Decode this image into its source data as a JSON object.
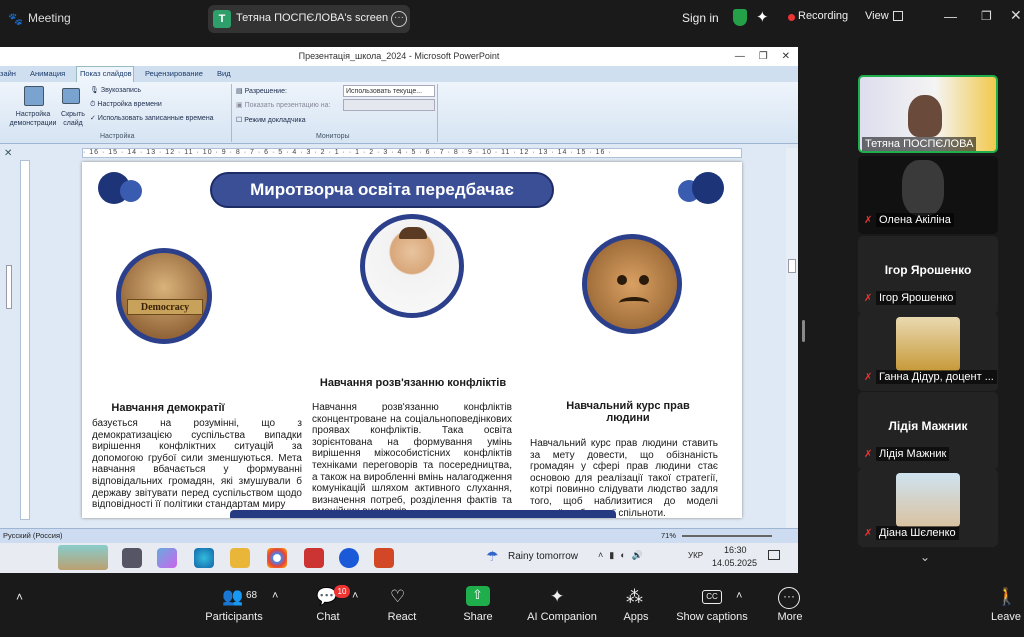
{
  "top": {
    "app_title": "Meeting",
    "sharer_initial": "Т",
    "sharer_label": "Тетяна ПОСПЄЛОВА's screen",
    "sign_in": "Sign in",
    "recording": "Recording",
    "view": "View"
  },
  "ppt": {
    "window_title": "Презентація_школа_2024 - Microsoft PowerPoint",
    "tabs": [
      "зайн",
      "Анимация",
      "Показ слайдов",
      "Рецензирование",
      "Вид"
    ],
    "ribbon": {
      "setup_label": "Настройка демонстрации",
      "hide_label": "Скрыть слайд",
      "record_narration": "Звукозапись",
      "rehearse": "Настройка времени",
      "use_timings": "Использовать записанные времена",
      "group_setup": "Настройка",
      "resolution": "Разрешение:",
      "resolution_value": "Использовать текуще...",
      "show_on": "Показать презентацию на:",
      "presenter_view": "Режим докладчика",
      "group_monitors": "Мониторы"
    },
    "ruler": "· 16 · 15 · 14 · 13 · 12 · 11 · 10 · 9 · 8 · 7 · 6 · 5 · 4 · 3 · 2 · 1 · · 1 · 2 · 3 · 4 · 5 · 6 · 7 · 8 · 9 · 10 · 11 · 12 · 13 · 14 · 15 · 16 ·",
    "status_lang": "Русский (Россия)",
    "zoom": "71%"
  },
  "slide": {
    "banner": "Миротворча освіта передбачає",
    "items": [
      {
        "title": "Навчання демократії",
        "badge": "Democracy",
        "text": "базується на розумінні, що з демократизацією суспільства випадки вирішення конфліктних ситуацій за допомогою грубої сили зменшуються. Мета навчання вбачається у формуванні відповідальних громадян, які змушували б державу звітувати перед суспільством щодо відповідності її політики стандартам миру"
      },
      {
        "title": "Навчання розв'язанню конфліктів",
        "text": "Навчання розв'язанню конфліктів сконцентроване на соціальноповедінкових проявах конфліктів. Така освіта зорієнтована на формування умінь вирішення міжособистісних конфліктів техніками переговорів та посередництва, а також на виробленні вмінь налагодження комунікацій шляхом активного слухання, визначення потреб, розділення фактів та емоційних висновків.."
      },
      {
        "title": "Навчальний курс прав людини",
        "text": "Навчальний курс прав людини ставить за мету довести, що обізнаність громадян у сфері прав людини стає основою для реалізації такої стратегії, котрі повинно слідувати людство задля того, щоб наблизитися до моделі мирної глобальної спільноти."
      }
    ]
  },
  "taskbar": {
    "weather": "Rainy tomorrow",
    "lang": "УКР",
    "time": "16:30",
    "date": "14.05.2025"
  },
  "participants": [
    {
      "name": "Тетяна ПОСПЄЛОВА",
      "video": true,
      "muted": false
    },
    {
      "name": "Олена Акіліна",
      "video": true,
      "muted": true
    },
    {
      "name": "Ігор Ярошенко",
      "video": false,
      "muted": true
    },
    {
      "name": "Ганна Дідур, доцент ...",
      "video": true,
      "muted": true
    },
    {
      "name": "Лідія Мажник",
      "video": false,
      "muted": true
    },
    {
      "name": "Діана Шєленко",
      "video": true,
      "muted": true
    }
  ],
  "bottombar": {
    "participants_label": "Participants",
    "participants_count": "68",
    "chat_label": "Chat",
    "chat_badge": "10",
    "react_label": "React",
    "share_label": "Share",
    "ai_label": "AI Companion",
    "apps_label": "Apps",
    "captions_label": "Show captions",
    "more_label": "More",
    "leave_label": "Leave"
  }
}
